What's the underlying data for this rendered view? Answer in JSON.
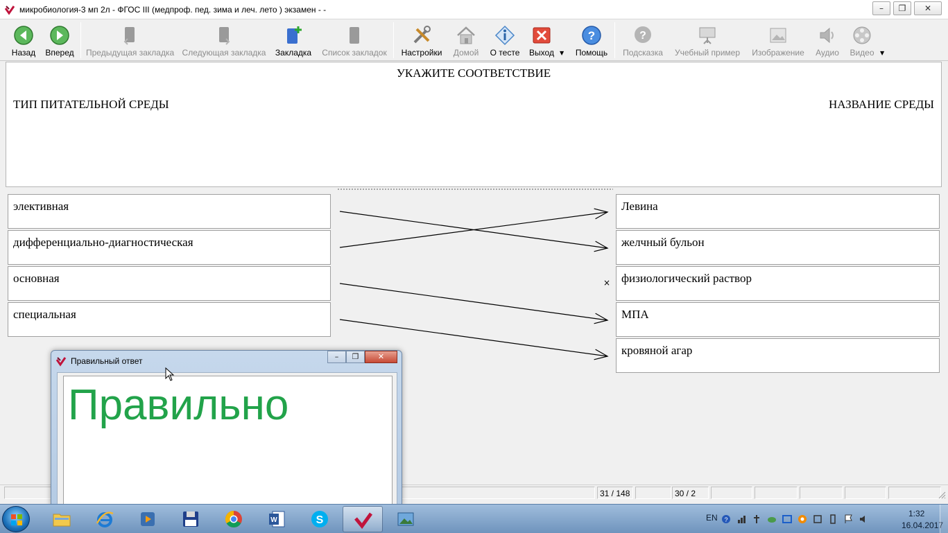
{
  "window": {
    "title": "микробиология-3 мп 2л - ФГОС III (медпроф. пед. зима и леч. лето ) экзамен -  -",
    "minimize": "–",
    "maximize": "❐",
    "close": "✕"
  },
  "toolbar": {
    "back": "Назад",
    "forward": "Вперед",
    "prev_bookmark": "Предыдущая закладка",
    "next_bookmark": "Следующая закладка",
    "bookmark": "Закладка",
    "bookmark_list": "Список закладок",
    "settings": "Настройки",
    "home": "Домой",
    "about": "О тесте",
    "exit": "Выход",
    "help": "Помощь",
    "hint": "Подсказка",
    "example": "Учебный пример",
    "image": "Изображение",
    "audio": "Аудио",
    "video": "Видео"
  },
  "question": {
    "title": "УКАЖИТЕ СООТВЕТСТВИЕ",
    "left_header": "ТИП ПИТАТЕЛЬНОЙ СРЕДЫ",
    "right_header": "НАЗВАНИЕ СРЕДЫ"
  },
  "matching": {
    "left": [
      "элективная",
      "дифференциально-диагностическая",
      "основная",
      "специальная"
    ],
    "right": [
      "Левина",
      "желчный бульон",
      "физиологический раствор",
      "МПА",
      "кровяной агар"
    ],
    "pairs": [
      [
        0,
        1
      ],
      [
        1,
        0
      ],
      [
        2,
        3
      ],
      [
        3,
        4
      ]
    ],
    "unmatched_mark": "×"
  },
  "status": {
    "question_counter": "31 / 148",
    "answered_counter": "30 / 2"
  },
  "popup": {
    "title": "Правильный ответ",
    "answer": "Правильно",
    "answer_color": "#22a34a",
    "minimize": "–",
    "maximize": "❐",
    "close": "✕"
  },
  "taskbar": {
    "language": "EN",
    "time": "1:32",
    "date": "16.04.2017",
    "apps": [
      "explorer",
      "internet-explorer",
      "media-player",
      "floppy-disk",
      "chrome",
      "word",
      "skype",
      "test-app",
      "image-viewer"
    ]
  }
}
